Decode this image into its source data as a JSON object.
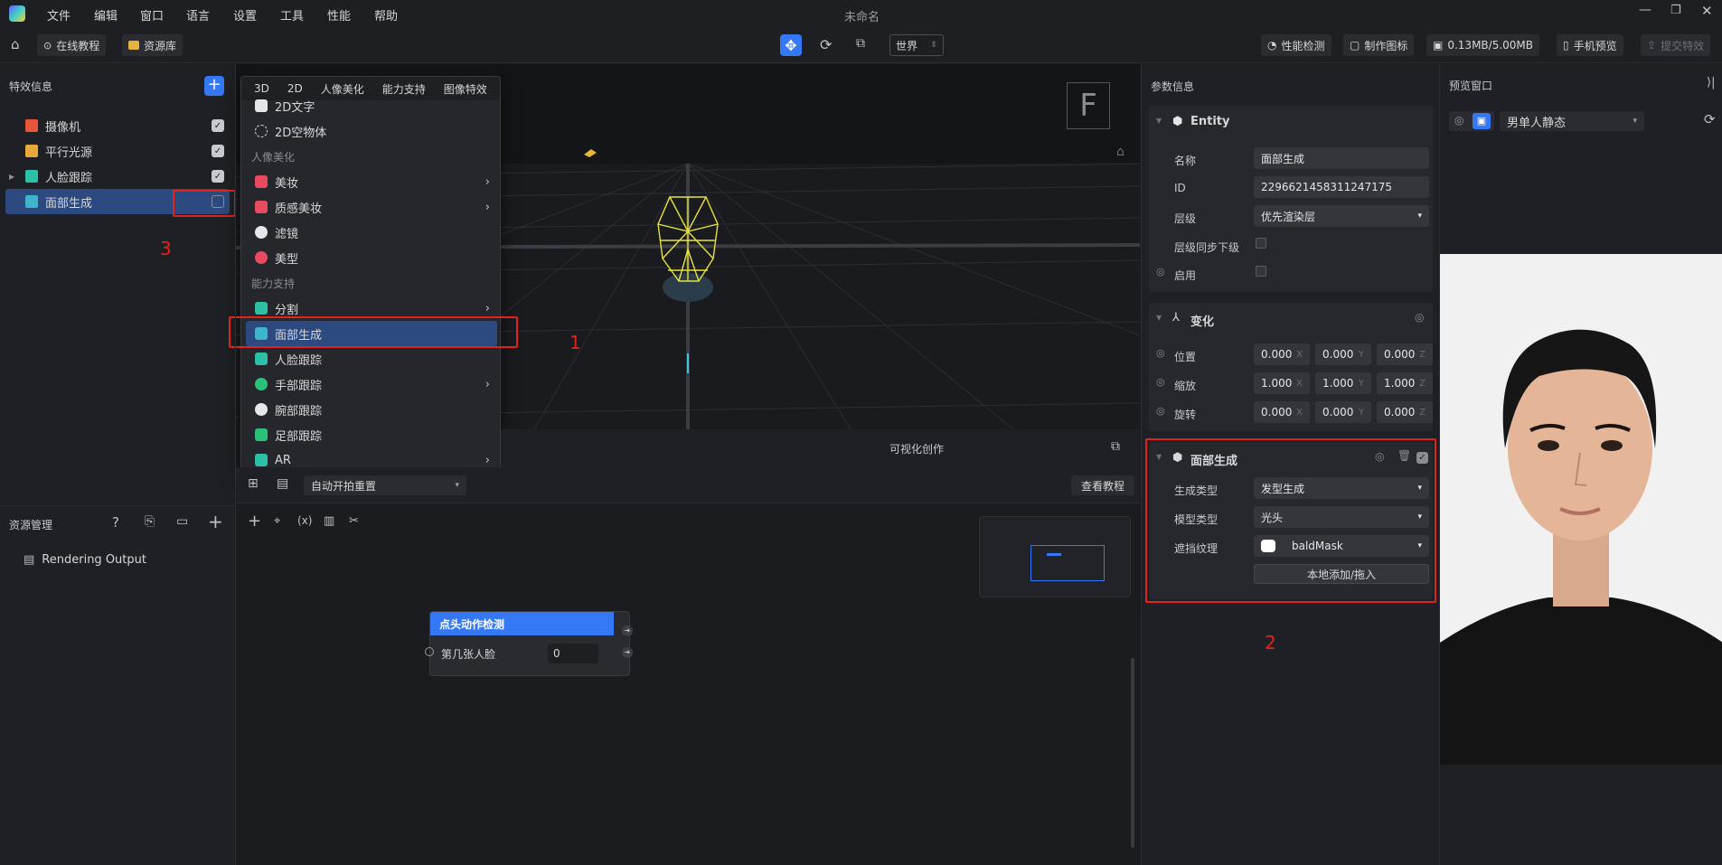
{
  "app": {
    "title": "未命名"
  },
  "menubar": [
    "文件",
    "编辑",
    "窗口",
    "语言",
    "设置",
    "工具",
    "性能",
    "帮助"
  ],
  "toolbar": {
    "online_tutorial": "在线教程",
    "asset_library": "资源库",
    "space_select": "世界",
    "perf_check": "性能检测",
    "make_icon": "制作图标",
    "size_usage": "0.13MB/5.00MB",
    "phone_preview": "手机预览",
    "submit_effect": "提交特效"
  },
  "effect_panel": {
    "title": "特效信息",
    "items": [
      {
        "label": "摄像机",
        "checked": true
      },
      {
        "label": "平行光源",
        "checked": true
      },
      {
        "label": "人脸跟踪",
        "checked": true
      },
      {
        "label": "面部生成",
        "checked": false
      }
    ]
  },
  "annotations": {
    "n1": "1",
    "n2": "2",
    "n3": "3"
  },
  "dropdown": {
    "tabs": [
      "3D",
      "2D",
      "人像美化",
      "能力支持",
      "图像特效"
    ],
    "items_top": [
      {
        "label": "2D文字"
      },
      {
        "label": "2D空物体"
      }
    ],
    "section_beauty": "人像美化",
    "items_beauty": [
      {
        "label": "美妆",
        "submenu": true
      },
      {
        "label": "质感美妆",
        "submenu": true
      },
      {
        "label": "滤镜",
        "submenu": false
      },
      {
        "label": "美型",
        "submenu": false
      }
    ],
    "section_ability": "能力支持",
    "items_ability": [
      {
        "label": "分割",
        "submenu": true
      },
      {
        "label": "面部生成",
        "submenu": false
      },
      {
        "label": "人脸跟踪",
        "submenu": false
      },
      {
        "label": "手部跟踪",
        "submenu": true
      },
      {
        "label": "腕部跟踪",
        "submenu": false
      },
      {
        "label": "足部跟踪",
        "submenu": false
      },
      {
        "label": "AR",
        "submenu": true
      }
    ]
  },
  "viewport": {
    "gizmo_label": "F",
    "visual_creation": "可视化创作"
  },
  "graph_toolbar": {
    "auto_reset_select": "自动开拍重置",
    "tutorial_button": "查看教程"
  },
  "graph_node": {
    "title": "点头动作检测",
    "param_label": "第几张人脸",
    "param_value": "0"
  },
  "asset_panel": {
    "title": "资源管理",
    "items": [
      "Rendering Output"
    ]
  },
  "params": {
    "title": "参数信息",
    "entity": {
      "header": "Entity",
      "name_label": "名称",
      "name_value": "面部生成",
      "id_label": "ID",
      "id_value": "2296621458311247175",
      "layer_label": "层级",
      "layer_value": "优先渲染层",
      "sync_label": "层级同步下级",
      "enable_label": "启用"
    },
    "transform": {
      "header": "变化",
      "position_label": "位置",
      "position": [
        "0.000",
        "0.000",
        "0.000"
      ],
      "scale_label": "缩放",
      "scale": [
        "1.000",
        "1.000",
        "1.000"
      ],
      "rotation_label": "旋转",
      "rotation": [
        "0.000",
        "0.000",
        "0.000"
      ],
      "axes": [
        "X",
        "Y",
        "Z"
      ]
    },
    "face_gen": {
      "header": "面部生成",
      "gen_type_label": "生成类型",
      "gen_type_value": "发型生成",
      "model_type_label": "模型类型",
      "model_type_value": "光头",
      "mask_label": "遮挡纹理",
      "mask_value": "baldMask",
      "add_button": "本地添加/拖入"
    }
  },
  "preview": {
    "title": "预览窗口",
    "model_select": "男单人静态"
  }
}
